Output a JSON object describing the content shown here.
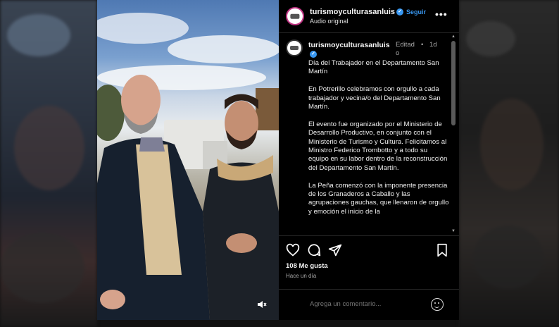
{
  "post": {
    "username": "turismoyculturasanluis",
    "follow_label": "Seguir",
    "audio": "Audio original",
    "caption_username": "turismoyculturasanluis",
    "edited_label": "Editado",
    "dot": "•",
    "time_short": "1d",
    "caption_paragraphs": [
      "Día del Trabajador en el Departamento San Martín",
      "En Potrerillo celebramos con orgullo a cada trabajador y vecina/o del Departamento San Martín.",
      "El evento fue organizado por el Ministerio de Desarrollo Productivo, en conjunto con el Ministerio de Turismo y Cultura. Felicitamos al Ministro Federico Trombotto y a todo su equipo en su labor dentro de la reconstrucción del Departamento San Martín.",
      "La Peña comenzó con la imponente presencia de los Granaderos a Caballo y las agrupaciones gauchas, que llenaron de orgullo y emoción el inicio de la"
    ],
    "likes": "108 Me gusta",
    "time_ago": "Hace un día",
    "comment_placeholder": "Agrega un comentario..."
  },
  "icons": {
    "more": "more-options-icon",
    "like": "heart-icon",
    "comment": "comment-icon",
    "share": "share-icon",
    "save": "bookmark-icon",
    "emoji": "emoji-icon",
    "mute": "mute-icon",
    "verified": "verified-badge-icon"
  },
  "colors": {
    "background": "#000000",
    "link": "#3897f0",
    "muted_text": "#a8a8a8"
  }
}
